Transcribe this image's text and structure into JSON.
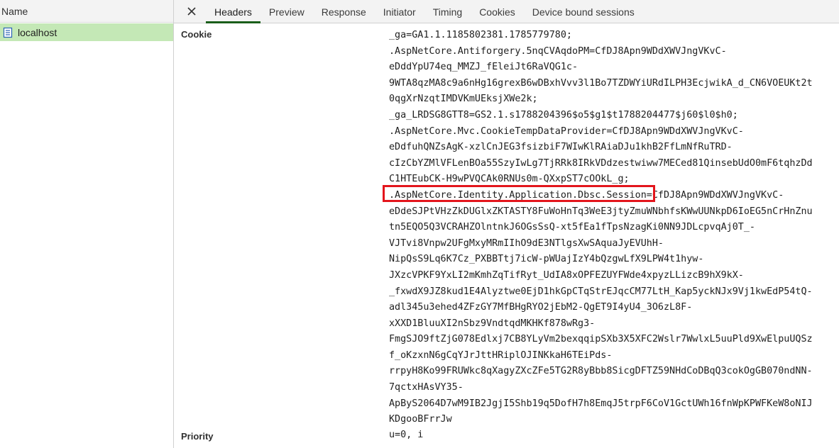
{
  "left_panel": {
    "column_header": "Name",
    "requests": [
      {
        "name": "localhost",
        "icon": "document-icon"
      }
    ]
  },
  "tabs": [
    "Headers",
    "Preview",
    "Response",
    "Initiator",
    "Timing",
    "Cookies",
    "Device bound sessions"
  ],
  "active_tab": "Headers",
  "headers": {
    "cookie": {
      "name": "Cookie",
      "lines": [
        "_ga=GA1.1.1185802381.1785779780;",
        ".AspNetCore.Antiforgery.5nqCVAqdoPM=CfDJ8Apn9WDdXWVJngVKvC-",
        "eDddYpU74eq_MMZJ_fEleiJt6RaVQG1c-",
        "9WTA8qzMA8c9a6nHg16grexB6wDBxhVvv3l1Bo7TZDWYiURdILPH3EcjwikA_d_CN6VOEUKt2t",
        "0qgXrNzqtIMDVKmUEksjXWe2k;",
        "_ga_LRDSG8GTT8=GS2.1.s1788204396$o5$g1$t1788204477$j60$l0$h0;",
        ".AspNetCore.Mvc.CookieTempDataProvider=CfDJ8Apn9WDdXWVJngVKvC-",
        "eDdfuhQNZsAgK-xzlCnJEG3fsizbiF7WIwKlRAiaDJu1khB2FfLmNfRuTRD-",
        "cIzCbYZMlVFLenBOa55SzyIwLg7TjRRk8IRkVDdzestwiww7MECed81QinsebUdO0mF6tqhzDd",
        "C1HTEubCK-H9wPVQCAk0RNUs0m-QXxpST7cOOkL_g;",
        ".AspNetCore.Identity.Application.Dbsc.Session=CfDJ8Apn9WDdXWVJngVKvC-",
        "eDdeSJPtVHzZkDUGlxZKTASTY8FuWoHnTq3WeE3jtyZmuWNbhfsKWwUUNkpD6IoEG5nCrHnZnu",
        "tn5EQO5Q3VCRAHZOlntnkJ6OGsSsQ-xt5fEa1fTpsNzagKi0NN9JDLcpvqAj0T_-",
        "VJTvi8Vnpw2UFgMxyMRmIIhO9dE3NTlgsXwSAquaJyEVUhH-",
        "NipQsS9Lq6K7Cz_PXBBTtj7icW-pWUajIzY4bQzgwLfX9LPW4t1hyw-",
        "JXzcVPKF9YxLI2mKmhZqTifRyt_UdIA8xOPFEZUYFWde4xpyzLLizcB9hX9kX-",
        "_fxwdX9JZ8kud1E4Alyztwe0EjD1hkGpCTqStrEJqcCM77LtH_Kap5yckNJx9Vj1kwEdP54tQ-",
        "adl345u3ehed4ZFzGY7MfBHgRYO2jEbM2-QgET9I4yU4_3O6zL8F-",
        "xXXD1BluuXI2nSbz9VndtqdMKHKf878wRg3-",
        "FmgSJO9ftZjG078Edlxj7CB8YLyVm2bexqqipSXb3X5XFC2Wslr7WwlxL5uuPld9XwElpuUQSz",
        "f_oKzxnN6gCqYJrJttHRiplOJINKkaH6TEiPds-",
        "rrpyH8Ko99FRUWkc8qXagyZXcZFe5TG2R8yBbb8SicgDFTZ59NHdCoDBqQ3cokOgGB070ndNN-",
        "7qctxHAsVY35-",
        "ApByS2064D7wM9IB2JgjI5Shb19q5DofH7h8EmqJ5trpF6CoV1GctUWh16fnWpKPWFKeW8oNIJ",
        "KDgooBFrrJw"
      ]
    },
    "priority": {
      "name": "Priority",
      "value": "u=0, i"
    }
  },
  "highlight": {
    "text": ".AspNetCore.Identity.Application.Dbsc.Session",
    "color": "#e3151c"
  },
  "colors": {
    "selected_row": "#c4e8b6",
    "active_tab_underline": "#1a5e1a"
  }
}
